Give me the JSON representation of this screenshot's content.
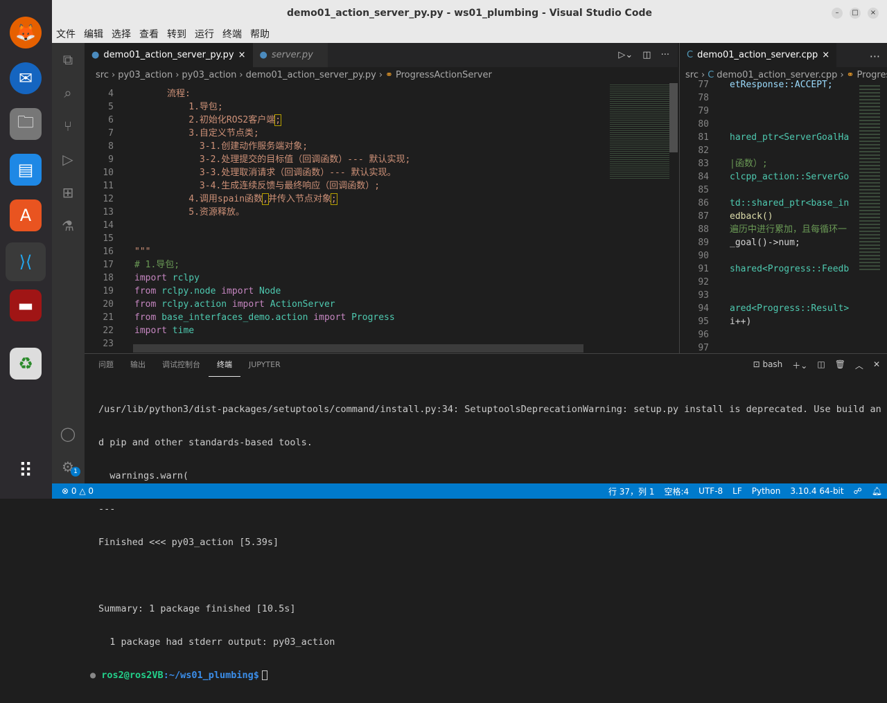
{
  "window": {
    "title": "demo01_action_server_py.py - ws01_plumbing - Visual Studio Code"
  },
  "menu": [
    "文件",
    "编辑",
    "选择",
    "查看",
    "转到",
    "运行",
    "终端",
    "帮助"
  ],
  "left_editor": {
    "tabs": [
      {
        "label": "demo01_action_server_py.py",
        "active": true
      },
      {
        "label": "server.py",
        "active": false
      }
    ],
    "breadcrumb": [
      "src",
      "py03_action",
      "py03_action",
      "demo01_action_server_py.py",
      "ProgressActionServer"
    ],
    "lines": [
      {
        "n": "4",
        "segs": [
          [
            "      流程:",
            "s"
          ]
        ]
      },
      {
        "n": "5",
        "segs": [
          [
            "          1.导包;",
            "s"
          ]
        ]
      },
      {
        "n": "6",
        "segs": [
          [
            "          2.初始化ROS2客户端",
            "s"
          ],
          [
            ";",
            "s b"
          ]
        ]
      },
      {
        "n": "7",
        "segs": [
          [
            "          3.自定义节点类;",
            "s"
          ]
        ]
      },
      {
        "n": "8",
        "segs": [
          [
            "            3-1.创建动作服务端对象;",
            "s"
          ]
        ]
      },
      {
        "n": "9",
        "segs": [
          [
            "            3-2.处理提交的目标值（回调函数）--- 默认实现;",
            "s"
          ]
        ]
      },
      {
        "n": "10",
        "segs": [
          [
            "            3-3.处理取消请求（回调函数）--- 默认实现。",
            "s"
          ]
        ]
      },
      {
        "n": "11",
        "segs": [
          [
            "            3-4.生成连续反馈与最终响应（回调函数）;",
            "s"
          ]
        ]
      },
      {
        "n": "12",
        "segs": [
          [
            "          4.调用spain函数",
            "s"
          ],
          [
            ",",
            "s b"
          ],
          [
            "并传入节点对象",
            "s"
          ],
          [
            ";",
            "s b"
          ]
        ]
      },
      {
        "n": "13",
        "segs": [
          [
            "          5.资源释放。",
            "s"
          ]
        ]
      },
      {
        "n": "14",
        "segs": []
      },
      {
        "n": "15",
        "segs": []
      },
      {
        "n": "16",
        "segs": [
          [
            "\"\"\"",
            "s"
          ]
        ]
      },
      {
        "n": "17",
        "segs": [
          [
            "# 1.导包;",
            "c"
          ]
        ]
      },
      {
        "n": "18",
        "segs": [
          [
            "import ",
            "k"
          ],
          [
            "rclpy",
            "m"
          ]
        ]
      },
      {
        "n": "19",
        "segs": [
          [
            "from ",
            "k"
          ],
          [
            "rclpy.node ",
            "m"
          ],
          [
            "import ",
            "k"
          ],
          [
            "Node",
            "m"
          ]
        ]
      },
      {
        "n": "20",
        "segs": [
          [
            "from ",
            "k"
          ],
          [
            "rclpy.action ",
            "m"
          ],
          [
            "import ",
            "k"
          ],
          [
            "ActionServer",
            "m"
          ]
        ]
      },
      {
        "n": "21",
        "segs": [
          [
            "from ",
            "k"
          ],
          [
            "base_interfaces_demo.action ",
            "m"
          ],
          [
            "import ",
            "k"
          ],
          [
            "Progress",
            "m"
          ]
        ]
      },
      {
        "n": "22",
        "segs": [
          [
            "import ",
            "k"
          ],
          [
            "time",
            "m"
          ]
        ]
      },
      {
        "n": "23",
        "segs": []
      }
    ]
  },
  "right_editor": {
    "tabs": [
      {
        "label": "demo01_action_server.cpp",
        "active": true
      }
    ],
    "breadcrumb": [
      "src",
      "demo01_action_server.cpp",
      "Progres"
    ],
    "lines": [
      {
        "n": "77",
        "segs": [
          [
            "etResponse::ACCEPT;",
            "p"
          ]
        ]
      },
      {
        "n": "78",
        "segs": []
      },
      {
        "n": "79",
        "segs": []
      },
      {
        "n": "80",
        "segs": []
      },
      {
        "n": "81",
        "segs": [
          [
            "hared_ptr<ServerGoalHa",
            "m"
          ]
        ]
      },
      {
        "n": "82",
        "segs": []
      },
      {
        "n": "83",
        "segs": [
          [
            "|函数）;",
            "c"
          ]
        ]
      },
      {
        "n": "84",
        "segs": [
          [
            "clcpp_action::ServerGo",
            "m"
          ]
        ]
      },
      {
        "n": "85",
        "segs": []
      },
      {
        "n": "86",
        "segs": [
          [
            "td::shared_ptr<base_in",
            "m"
          ]
        ]
      },
      {
        "n": "87",
        "segs": [
          [
            "edback()",
            "f"
          ]
        ]
      },
      {
        "n": "88",
        "segs": [
          [
            "遍历中进行累加，且每循环一",
            "c"
          ]
        ]
      },
      {
        "n": "89",
        "segs": [
          [
            "_goal()->num;",
            "w"
          ]
        ]
      },
      {
        "n": "90",
        "segs": []
      },
      {
        "n": "91",
        "segs": [
          [
            "shared<Progress::Feedb",
            "m"
          ]
        ]
      },
      {
        "n": "92",
        "segs": []
      },
      {
        "n": "93",
        "segs": []
      },
      {
        "n": "94",
        "segs": [
          [
            "ared<Progress::Result>",
            "m"
          ]
        ]
      },
      {
        "n": "95",
        "segs": [
          [
            "i++)",
            "w"
          ]
        ]
      },
      {
        "n": "96",
        "segs": []
      },
      {
        "n": "97",
        "segs": []
      }
    ]
  },
  "panel": {
    "tabs": [
      "问题",
      "输出",
      "调试控制台",
      "终端",
      "JUPYTER"
    ],
    "active_tab": "终端",
    "shell": "bash",
    "terminal": [
      "/usr/lib/python3/dist-packages/setuptools/command/install.py:34: SetuptoolsDeprecationWarning: setup.py install is deprecated. Use build an",
      "d pip and other standards-based tools.",
      "  warnings.warn(",
      "---",
      "Finished <<< py03_action [5.39s]",
      "",
      "Summary: 1 package finished [10.5s]",
      "  1 package had stderr output: py03_action"
    ],
    "prompt_user": "ros2@ros2VB",
    "prompt_path": ":~/ws01_plumbing$"
  },
  "status": {
    "errors": "0",
    "warnings": "0",
    "position": "行 37，列 1",
    "spaces": "空格:4",
    "encoding": "UTF-8",
    "eol": "LF",
    "language": "Python",
    "interpreter": "3.10.4 64-bit"
  },
  "dock": {
    "badge": "1"
  }
}
